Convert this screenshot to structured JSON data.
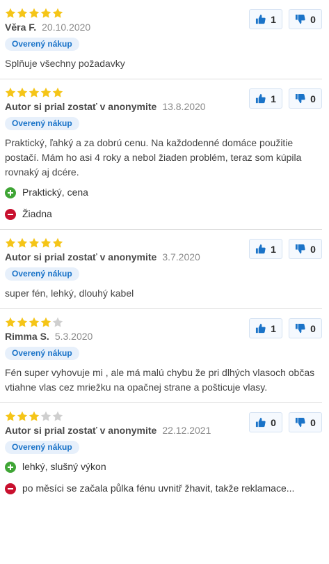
{
  "colors": {
    "star_filled": "#f5c518",
    "star_empty": "#cfcfcf",
    "badge_bg": "#e7f0fb",
    "badge_text": "#1a73c8",
    "thumb_blue": "#1a73c8",
    "pro_green": "#3fa535",
    "con_red": "#c8102e"
  },
  "icons": {
    "star": "star-icon",
    "vote_up": "thumbs-up-icon",
    "vote_down": "thumbs-down-icon",
    "pro": "plus-circle-icon",
    "con": "minus-circle-icon"
  },
  "reviews": [
    {
      "rating": 5,
      "author": "Věra F.",
      "date": "20.10.2020",
      "badge": "Overený nákup",
      "text": "Splňuje všechny požadavky",
      "pros": [],
      "cons": [],
      "votes_up": "1",
      "votes_down": "0"
    },
    {
      "rating": 5,
      "author": "Autor si prial zostať v anonymite",
      "date": "13.8.2020",
      "badge": "Overený nákup",
      "text": "Praktický, ľahký a za dobrú cenu. Na každodenné domáce použitie postačí. Mám ho asi 4 roky a nebol žiaden problém, teraz som kúpila rovnaký aj dcére.",
      "pros": [
        "Praktický, cena"
      ],
      "cons": [
        "Žiadna"
      ],
      "votes_up": "1",
      "votes_down": "0"
    },
    {
      "rating": 5,
      "author": "Autor si prial zostať v anonymite",
      "date": "3.7.2020",
      "badge": "Overený nákup",
      "text": "super fén, lehký, dlouhý kabel",
      "pros": [],
      "cons": [],
      "votes_up": "1",
      "votes_down": "0"
    },
    {
      "rating": 4,
      "author": "Rimma S.",
      "date": "5.3.2020",
      "badge": "Overený nákup",
      "text": "Fén super vyhovuje mi , ale má malú chybu že pri dlhých vlasoch občas vtiahne vlas cez mriežku na opačnej strane a pošticuje vlasy.",
      "pros": [],
      "cons": [],
      "votes_up": "1",
      "votes_down": "0"
    },
    {
      "rating": 3,
      "author": "Autor si prial zostať v anonymite",
      "date": "22.12.2021",
      "badge": "Overený nákup",
      "text": "",
      "pros": [
        "lehký, slušný výkon"
      ],
      "cons": [
        "po měsíci se začala půlka fénu uvnitř žhavit, takže reklamace..."
      ],
      "votes_up": "0",
      "votes_down": "0"
    }
  ]
}
